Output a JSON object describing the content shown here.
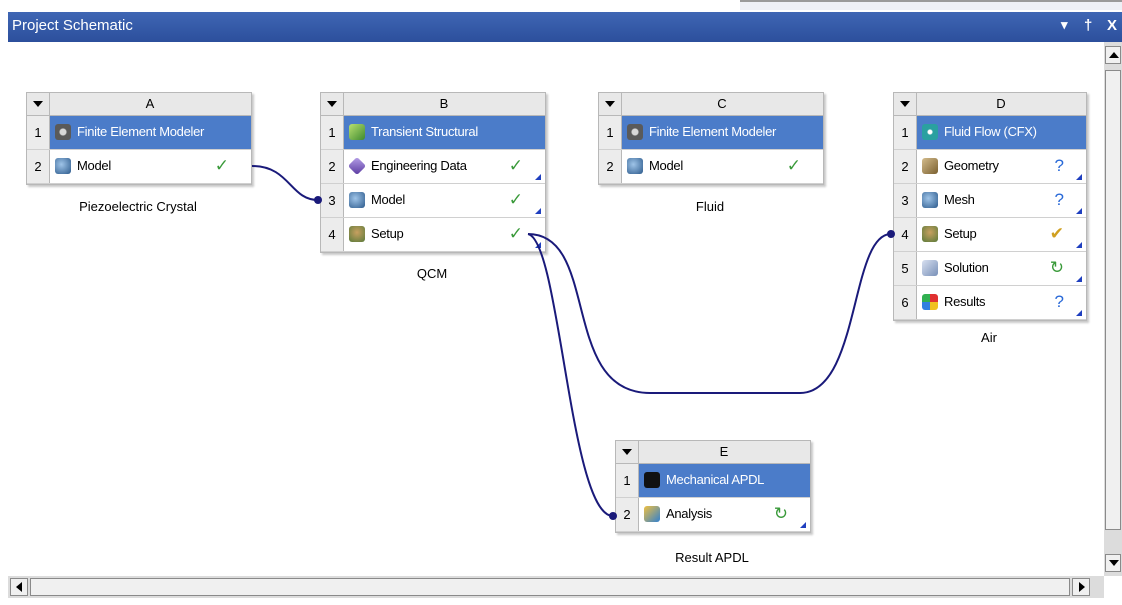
{
  "window": {
    "title": "Project Schematic",
    "pin": "†",
    "close": "X",
    "menu": "▾"
  },
  "systems": {
    "A": {
      "letter": "A",
      "caption": "Piezoelectric Crystal",
      "rows": [
        {
          "num": "1",
          "label": "Finite Element Modeler"
        },
        {
          "num": "2",
          "label": "Model",
          "status": "✓"
        }
      ]
    },
    "B": {
      "letter": "B",
      "caption": "QCM",
      "rows": [
        {
          "num": "1",
          "label": "Transient Structural"
        },
        {
          "num": "2",
          "label": "Engineering Data",
          "status": "✓"
        },
        {
          "num": "3",
          "label": "Model",
          "status": "✓"
        },
        {
          "num": "4",
          "label": "Setup",
          "status": "✓"
        }
      ]
    },
    "C": {
      "letter": "C",
      "caption": "Fluid",
      "rows": [
        {
          "num": "1",
          "label": "Finite Element Modeler"
        },
        {
          "num": "2",
          "label": "Model",
          "status": "✓"
        }
      ]
    },
    "D": {
      "letter": "D",
      "caption": "Air",
      "rows": [
        {
          "num": "1",
          "label": "Fluid Flow (CFX)"
        },
        {
          "num": "2",
          "label": "Geometry",
          "status": "?"
        },
        {
          "num": "3",
          "label": "Mesh",
          "status": "?"
        },
        {
          "num": "4",
          "label": "Setup",
          "status": "✔"
        },
        {
          "num": "5",
          "label": "Solution",
          "status": "↻"
        },
        {
          "num": "6",
          "label": "Results",
          "status": "?"
        }
      ]
    },
    "E": {
      "letter": "E",
      "caption": "Result APDL",
      "rows": [
        {
          "num": "1",
          "label": "Mechanical APDL"
        },
        {
          "num": "2",
          "label": "Analysis",
          "status": "↻"
        }
      ]
    }
  },
  "colors": {
    "header_row": "#4b7cc9",
    "title_bar": "#2c4f9c",
    "link": "#1a1a7a",
    "check": "#3a9a3a",
    "question": "#2a6ad8"
  }
}
